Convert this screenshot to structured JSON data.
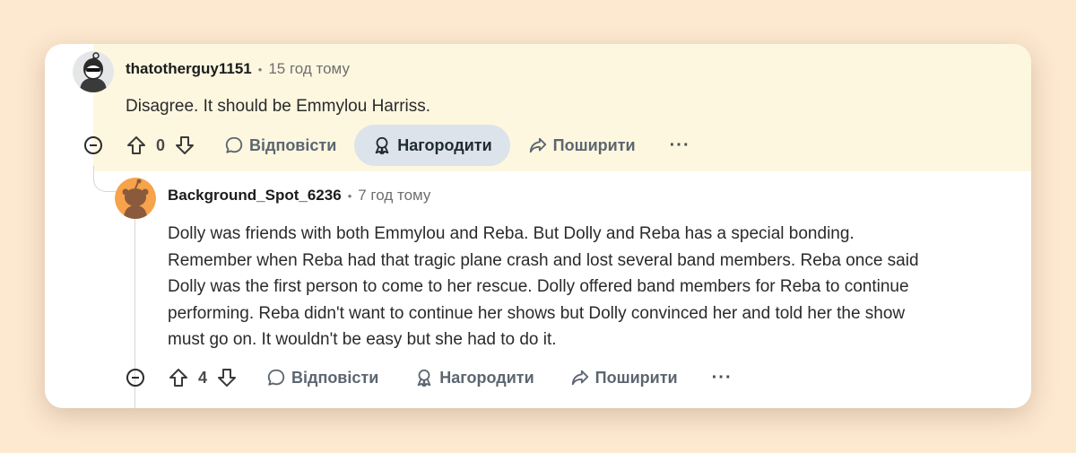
{
  "comments": [
    {
      "username": "thatotherguy1151",
      "separator": "•",
      "time": "15 год тому",
      "text": "Disagree. It should be Emmylou Harriss.",
      "votes": "0",
      "reply_label": "Відповісти",
      "award_label": "Нагородити",
      "share_label": "Поширити",
      "more_label": "···"
    },
    {
      "username": "Background_Spot_6236",
      "separator": "•",
      "time": "7 год тому",
      "text_lines": [
        "Dolly was friends with both Emmylou and Reba. But Dolly and Reba has a special bonding.",
        "Remember when Reba had that tragic plane crash and lost several band members. Reba once said",
        "Dolly was the first person to come to her rescue. Dolly offered band members for Reba to continue",
        "performing. Reba didn't want to continue her shows but Dolly convinced her and told her the show",
        "must go on. It wouldn't be easy but she had to do it."
      ],
      "votes": "4",
      "reply_label": "Відповісти",
      "award_label": "Нагородити",
      "share_label": "Поширити",
      "more_label": "···"
    }
  ],
  "colors": {
    "page_background": "#fde8d0",
    "highlight_background": "#fdf7e0",
    "active_button": "#dde3ea",
    "avatar_orange": "#f7a34b"
  }
}
